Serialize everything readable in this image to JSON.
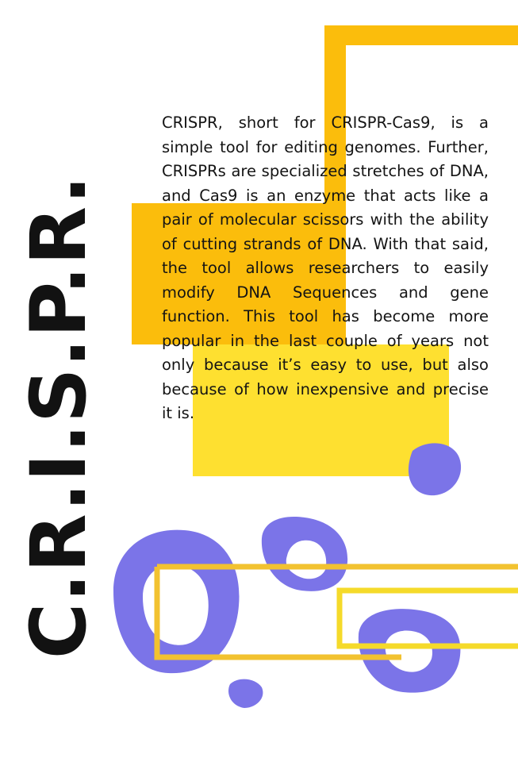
{
  "poster": {
    "vertical_title": "C.R.I.S.P.R.",
    "body": "CRISPR, short for CRISPR-Cas9, is a simple tool for editing genomes. Further, CRISPRs are specialized stretches of DNA, and Cas9 is an enzyme that acts like a pair of molecular scissors with the ability of cutting strands of DNA. With that said, the tool allows researchers to easily modify DNA Sequences and gene function. This tool has become more popular in the last couple of years not only because it’s easy to use, but also because of how inexpensive and precise it is."
  },
  "colors": {
    "orange": "#FBBD0C",
    "yellow": "#FEE030",
    "purple": "#7B74E8",
    "text": "#141414"
  }
}
